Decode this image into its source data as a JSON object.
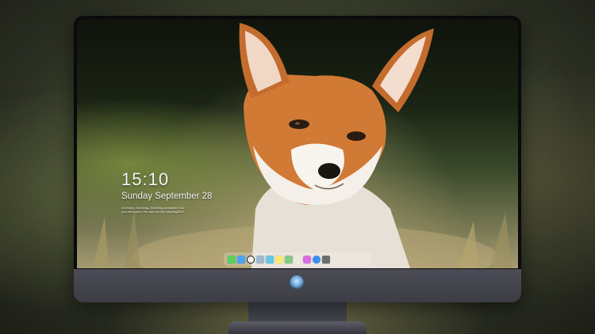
{
  "lockscreen": {
    "time": "15:10",
    "date": "Sunday September 28",
    "note_line1": "Inventory: brunstag, Enabling contacted. You",
    "note_line2": "you retrospect, For and the My handing2020"
  },
  "dock": {
    "icons": [
      {
        "name": "messages-icon",
        "color": "#5cd05c"
      },
      {
        "name": "finder-icon",
        "color": "#4aa3f0"
      },
      {
        "name": "clock-icon",
        "color": "#f2f2f2"
      },
      {
        "name": "preview-icon",
        "color": "#9fb7cf"
      },
      {
        "name": "clapper-icon",
        "color": "#66c6e8"
      },
      {
        "name": "notes-icon",
        "color": "#ffe77a"
      },
      {
        "name": "photos-icon",
        "color": "#86c985"
      },
      {
        "name": "music-icon",
        "color": "#d86be0"
      },
      {
        "name": "appstore-icon",
        "color": "#3b8ff0"
      },
      {
        "name": "camera-icon",
        "color": "#6b6b70"
      }
    ]
  },
  "monitor": {
    "logo": "monitor-logo-icon"
  }
}
